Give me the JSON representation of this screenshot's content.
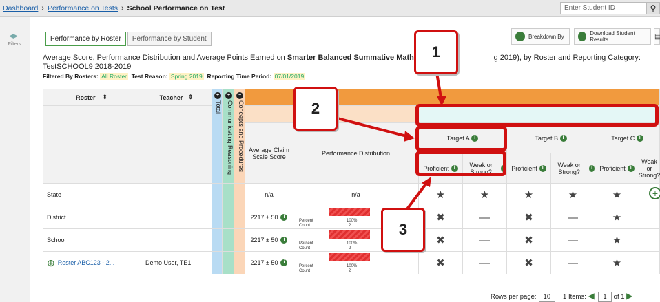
{
  "breadcrumb": {
    "items": [
      "Dashboard",
      "Performance on Tests"
    ],
    "current": "School Performance on Test"
  },
  "search": {
    "placeholder": "Enter Student ID"
  },
  "sidebar": {
    "label": "Filters"
  },
  "tabs": [
    "Performance by Roster",
    "Performance by Student"
  ],
  "toolbar": {
    "breakdown": "Breakdown By",
    "download": "Download Student Results",
    "print": "Print"
  },
  "description": {
    "part1": "Average Score, Performance Distribution and Average Points Earned on ",
    "bold": "Smarter Balanced Summative Mathematics",
    "part2": " (",
    "part3": "g 2019), by Roster and Reporting Category: TestSCHOOL9 2018-2019"
  },
  "filters": {
    "rosters_label": "Filtered By Rosters:",
    "rosters_value": "All Roster",
    "reason_label": "Test Reason:",
    "reason_value": "Spring 2019",
    "period_label": "Reporting Time Period:",
    "period_value": "07/01/2019"
  },
  "table": {
    "col_roster": "Roster",
    "col_teacher": "Teacher",
    "col_total": "Total",
    "col_comm": "Communicating Reasoning",
    "col_concepts": "Concepts and Procedures",
    "col_avg": "Average Claim Scale Score",
    "col_perf": "Performance Distribution",
    "targets": [
      "Target A",
      "Target B",
      "Target C"
    ],
    "proficient": "Proficient",
    "weak": "Weak or Strong?",
    "rows": [
      {
        "roster": "State",
        "teacher": "",
        "avg": "n/a",
        "perf": "n/a",
        "pct": "",
        "cnt": "",
        "syms": [
          "★",
          "★",
          "★",
          "★",
          "★"
        ]
      },
      {
        "roster": "District",
        "teacher": "",
        "avg": "2217 ± 50",
        "perf": "",
        "pct": "100%",
        "cnt": "2",
        "syms": [
          "✖",
          "—",
          "✖",
          "—",
          "★"
        ]
      },
      {
        "roster": "School",
        "teacher": "",
        "avg": "2217 ± 50",
        "perf": "",
        "pct": "100%",
        "cnt": "2",
        "syms": [
          "✖",
          "—",
          "✖",
          "—",
          "★"
        ]
      },
      {
        "roster": "Roster ABC123 - 2...",
        "teacher": "Demo User, TE1",
        "avg": "2217 ± 50",
        "perf": "",
        "pct": "100%",
        "cnt": "2",
        "syms": [
          "✖",
          "—",
          "✖",
          "—",
          "★"
        ]
      }
    ],
    "pd_percent": "Percent",
    "pd_count": "Count"
  },
  "callouts": [
    "1",
    "2",
    "3"
  ],
  "pager": {
    "rows_label": "Rows per page:",
    "rows_value": "10",
    "items": "1 Items:",
    "page": "1",
    "of": "of 1"
  }
}
